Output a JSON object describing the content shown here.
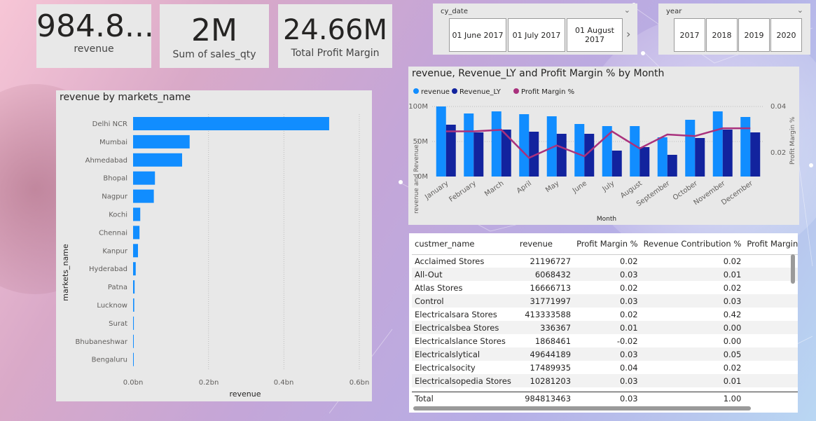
{
  "kpis": [
    {
      "value": "984.8...",
      "label": "revenue"
    },
    {
      "value": "2M",
      "label": "Sum of sales_qty"
    },
    {
      "value": "24.66M",
      "label": "Total Profit Margin"
    }
  ],
  "date_slicer": {
    "title": "cy_date",
    "tiles": [
      "01 June 2017",
      "01 July 2017",
      "01 August 2017"
    ]
  },
  "year_slicer": {
    "title": "year",
    "tiles": [
      "2017",
      "2018",
      "2019",
      "2020"
    ]
  },
  "combo_chart": {
    "title": "revenue, Revenue_LY and Profit Margin % by Month",
    "legend": [
      "revenue",
      "Revenue_LY",
      "Profit Margin %"
    ],
    "ylabel": "revenue and Revenue...",
    "y2label": "Profit Margin %",
    "xlabel": "Month",
    "yticks": [
      "100M",
      "50M",
      "0M"
    ],
    "y2ticks": [
      "0.04",
      "0.02"
    ]
  },
  "bar_chart": {
    "title": "revenue by markets_name",
    "ylabel": "markets_name",
    "xlabel": "revenue",
    "xticks": [
      "0.0bn",
      "0.2bn",
      "0.4bn",
      "0.6bn"
    ]
  },
  "chart_data": [
    {
      "type": "bar",
      "orientation": "horizontal",
      "title": "revenue by markets_name",
      "xlabel": "revenue",
      "ylabel": "markets_name",
      "categories": [
        "Delhi NCR",
        "Mumbai",
        "Ahmedabad",
        "Bhopal",
        "Nagpur",
        "Kochi",
        "Chennai",
        "Kanpur",
        "Hyderabad",
        "Patna",
        "Lucknow",
        "Surat",
        "Bhubaneshwar",
        "Bengaluru"
      ],
      "values": [
        0.52,
        0.15,
        0.13,
        0.058,
        0.055,
        0.019,
        0.017,
        0.013,
        0.007,
        0.004,
        0.003,
        0.002,
        0.001,
        0.0005
      ],
      "xlim": [
        0,
        0.6
      ],
      "unit": "bn",
      "color": "#118dff",
      "grid": true
    },
    {
      "type": "bar",
      "title": "revenue, Revenue_LY and Profit Margin % by Month",
      "xlabel": "Month",
      "ylabel": "revenue and Revenue...",
      "categories": [
        "January",
        "February",
        "March",
        "April",
        "May",
        "June",
        "July",
        "August",
        "September",
        "October",
        "November",
        "December"
      ],
      "series": [
        {
          "name": "revenue",
          "type": "bar",
          "color": "#118dff",
          "values": [
            100,
            90,
            93,
            89,
            86,
            75,
            72,
            72,
            56,
            81,
            93,
            85
          ]
        },
        {
          "name": "Revenue_LY",
          "type": "bar",
          "color": "#12239e",
          "values": [
            74,
            63,
            67,
            64,
            61,
            61,
            37,
            42,
            31,
            55,
            67,
            63
          ]
        },
        {
          "name": "Profit Margin %",
          "type": "line",
          "axis": "right",
          "color": "#a9317d",
          "values": [
            0.029,
            0.029,
            0.03,
            0.012,
            0.02,
            0.013,
            0.029,
            0.018,
            0.027,
            0.026,
            0.031,
            0.031
          ]
        }
      ],
      "ylim": [
        0,
        100
      ],
      "y2lim": [
        0,
        0.045
      ],
      "grid": true,
      "legend": "top-left"
    }
  ],
  "table": {
    "columns": [
      "custmer_name",
      "revenue",
      "Profit Margin %",
      "Revenue Contribution %",
      "Profit Margin Con"
    ],
    "rows": [
      [
        "Acclaimed Stores",
        "21196727",
        "0.02",
        "0.02"
      ],
      [
        "All-Out",
        "6068432",
        "0.03",
        "0.01"
      ],
      [
        "Atlas Stores",
        "16666713",
        "0.02",
        "0.02"
      ],
      [
        "Control",
        "31771997",
        "0.03",
        "0.03"
      ],
      [
        "Electricalsara Stores",
        "413333588",
        "0.02",
        "0.42"
      ],
      [
        "Electricalsbea Stores",
        "336367",
        "0.01",
        "0.00"
      ],
      [
        "Electricalslance Stores",
        "1868461",
        "-0.02",
        "0.00"
      ],
      [
        "Electricalslytical",
        "49644189",
        "0.03",
        "0.05"
      ],
      [
        "Electricalsocity",
        "17489935",
        "0.04",
        "0.02"
      ],
      [
        "Electricalsopedia Stores",
        "10281203",
        "0.03",
        "0.01"
      ]
    ],
    "total": [
      "Total",
      "984813463",
      "0.03",
      "1.00"
    ]
  }
}
